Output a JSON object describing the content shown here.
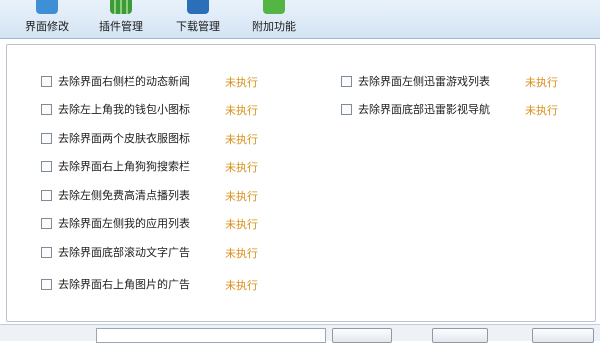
{
  "toolbar": {
    "items": [
      {
        "label": "界面修改",
        "icon": "interface-icon",
        "color": "#3f8fd6"
      },
      {
        "label": "插件管理",
        "icon": "plugin-icon",
        "color": "#3d9b3a"
      },
      {
        "label": "下载管理",
        "icon": "download-icon",
        "color": "#2a6fb8"
      },
      {
        "label": "附加功能",
        "icon": "extras-icon",
        "color": "#54b544"
      }
    ]
  },
  "options": {
    "status_color": "#d8901a",
    "left": [
      {
        "label": "去除界面右侧栏的动态新闻",
        "status": "未执行"
      },
      {
        "label": "去除左上角我的钱包小图标",
        "status": "未执行"
      },
      {
        "label": "去除界面两个皮肤衣服图标",
        "status": "未执行"
      },
      {
        "label": "去除界面右上角狗狗搜索栏",
        "status": "未执行"
      },
      {
        "label": "去除左侧免费高清点播列表",
        "status": "未执行"
      },
      {
        "label": "去除界面左侧我的应用列表",
        "status": "未执行"
      },
      {
        "label": "去除界面底部滚动文字广告",
        "status": "未执行"
      },
      {
        "label": "去除界面右上角图片的广告",
        "status": "未执行"
      }
    ],
    "right": [
      {
        "label": "去除界面左侧迅雷游戏列表",
        "status": "未执行"
      },
      {
        "label": "去除界面底部迅雷影视导航",
        "status": "未执行"
      }
    ]
  }
}
